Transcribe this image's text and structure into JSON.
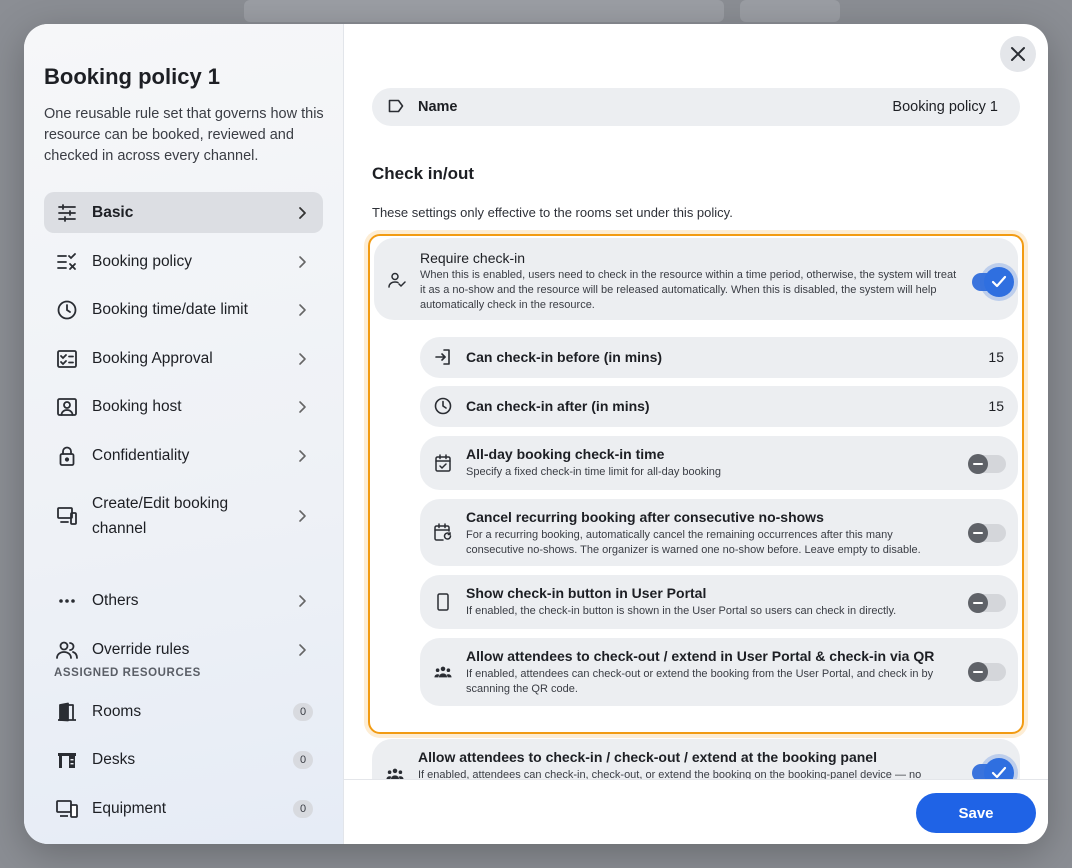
{
  "sidebar": {
    "title": "Booking policy 1",
    "description": "One reusable rule set that governs how this resource can be booked, reviewed and checked in across every channel.",
    "nav": [
      {
        "label": "Basic",
        "icon": "sliders-icon"
      },
      {
        "label": "Booking policy",
        "icon": "checklist-icon"
      },
      {
        "label": "Booking time/date limit",
        "icon": "clock-icon"
      },
      {
        "label": "Booking Approval",
        "icon": "approval-list-icon"
      },
      {
        "label": "Booking host",
        "icon": "host-icon"
      },
      {
        "label": "Confidentiality",
        "icon": "lock-icon"
      },
      {
        "label": "Create/Edit booking channel",
        "icon": "devices-icon"
      },
      {
        "label": "Others",
        "icon": "more-dots-icon"
      },
      {
        "label": "Override rules",
        "icon": "users-icon"
      }
    ],
    "assigned_label": "ASSIGNED RESOURCES",
    "resources": [
      {
        "label": "Rooms",
        "count": "0",
        "icon": "door-icon"
      },
      {
        "label": "Desks",
        "count": "0",
        "icon": "desk-icon"
      },
      {
        "label": "Equipment",
        "count": "0",
        "icon": "equipment-icon"
      }
    ]
  },
  "main": {
    "name_label": "Name",
    "name_value": "Booking policy 1",
    "section_title": "Check in/out",
    "section_desc": "These settings only effective to the rooms set under this policy.",
    "require": {
      "title": "Require check-in",
      "desc": "When this is enabled, users need to check in the resource within a time period, otherwise, the system will treat it as a no-show and the resource will be released automatically. When this is disabled, the system will help automatically check in the resource.",
      "enabled": true
    },
    "settings": [
      {
        "title": "Can check-in before (in mins)",
        "value": "15",
        "icon": "login-arrow-icon"
      },
      {
        "title": "Can check-in after (in mins)",
        "value": "15",
        "icon": "clock-icon"
      },
      {
        "title": "All-day booking check-in time",
        "desc": "Specify a fixed check-in time limit for all-day booking",
        "enabled": false,
        "icon": "calendar-check-icon"
      },
      {
        "title": "Cancel recurring booking after consecutive no-shows",
        "desc": "For a recurring booking, automatically cancel the remaining occurrences after this many consecutive no-shows. The organizer is warned one no-show before. Leave empty to disable.",
        "enabled": false,
        "icon": "calendar-repeat-icon"
      },
      {
        "title": "Show check-in button in User Portal",
        "desc": "If enabled, the check-in button is shown in the User Portal so users can check in directly.",
        "enabled": false,
        "icon": "phone-icon"
      },
      {
        "title": "Allow attendees to check-out / extend in User Portal & check-in via QR",
        "desc": "If enabled, attendees can check-out or extend the booking from the User Portal, and check in by scanning the QR code.",
        "enabled": false,
        "icon": "group-icon"
      }
    ],
    "panel": {
      "title": "Allow attendees to check-in / check-out / extend at the booking panel",
      "desc": "If enabled, attendees can check-in, check-out, or extend the booking on the booking-panel device — no",
      "enabled": true
    },
    "save_label": "Save"
  },
  "colors": {
    "accent": "#1f63e6",
    "highlight": "#f29b12",
    "toggle_on": "#2f6fe0"
  }
}
